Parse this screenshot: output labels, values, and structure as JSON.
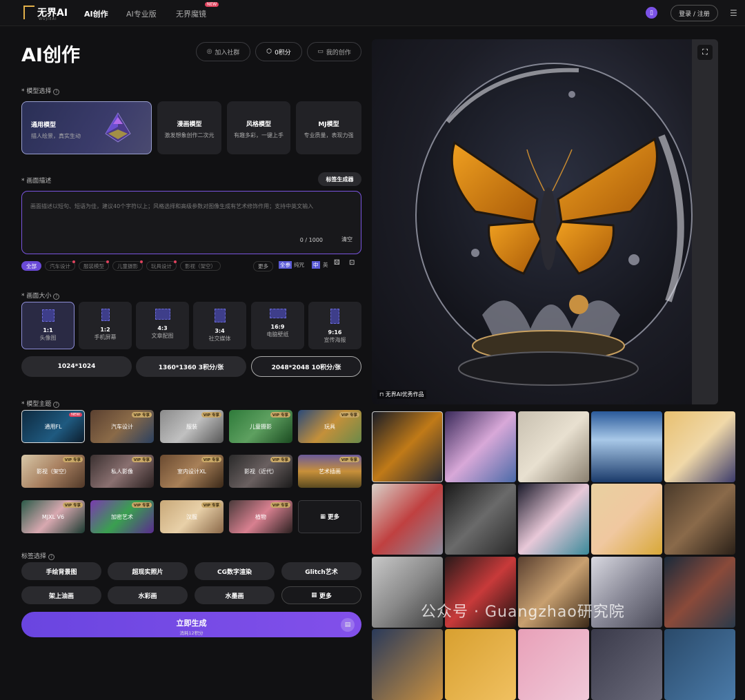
{
  "nav": {
    "logo_text": "无界AI",
    "logo_sub": "WUJIEAI",
    "items": [
      "AI创作",
      "AI专业版",
      "无界魔镜"
    ],
    "new_badge": "NEW",
    "login": "登录 / 注册"
  },
  "header": {
    "title": "AI创作",
    "join": "加入社群",
    "score": "0积分",
    "mine": "我的创作"
  },
  "model_section": {
    "label": "* 模型选择",
    "models": [
      {
        "name": "通用模型",
        "desc": "描人绘景，真实生动"
      },
      {
        "name": "漫画模型",
        "desc": "激发想象创作二次元"
      },
      {
        "name": "风格模型",
        "desc": "有趣多彩，一键上手"
      },
      {
        "name": "MJ模型",
        "desc": "专业质量，表现力强"
      }
    ]
  },
  "desc_section": {
    "label": "* 画面描述",
    "tag_gen": "标签生成器",
    "placeholder": "画面描述以短句、短语为佳，建议40个字符以上；风格选择和高级参数对图像生成有艺术修饰作用；支持中英文输入",
    "count": "0 / 1000",
    "clear": "清空",
    "chips": [
      "全部",
      "汽车设计",
      "服装模型",
      "儿童摄影",
      "玩具设计",
      "影视（架空）"
    ],
    "more": "更多",
    "quanzan": "全参",
    "chun": "纯咒",
    "zh": "中",
    "en": "英"
  },
  "size_section": {
    "label": "* 画面大小",
    "ratios": [
      {
        "ratio": "1:1",
        "label": "头像图"
      },
      {
        "ratio": "1:2",
        "label": "手机屏幕"
      },
      {
        "ratio": "4:3",
        "label": "文章配图"
      },
      {
        "ratio": "3:4",
        "label": "社交媒体"
      },
      {
        "ratio": "16:9",
        "label": "电脑壁纸"
      },
      {
        "ratio": "9:16",
        "label": "宣传海报"
      }
    ],
    "resolutions": [
      "1024*1024",
      "1360*1360 3积分/张",
      "2048*2048 10积分/张"
    ]
  },
  "theme_section": {
    "label": "* 模型主题",
    "vip": "VIP 专享",
    "themes": [
      "通用FL",
      "汽车设计",
      "服装",
      "儿童摄影",
      "玩具",
      "影视（架空）",
      "私人影像",
      "室内设计XL",
      "影视（近代）",
      "艺术插画",
      "MJXL V6",
      "加密艺术",
      "汉服",
      "植物"
    ],
    "more": "更多"
  },
  "tag_section": {
    "label": "标签选择",
    "tags": [
      "手绘背景图",
      "超现实照片",
      "CG数字渲染",
      "Glitch艺术",
      "架上油画",
      "水彩画",
      "水墨画"
    ],
    "more": "更多"
  },
  "generate": {
    "label": "立即生成",
    "cost": "消耗12积分"
  },
  "gallery": {
    "caption": "无界AI优秀作品",
    "watermark": "公众号 · Guangzhao研究院"
  }
}
